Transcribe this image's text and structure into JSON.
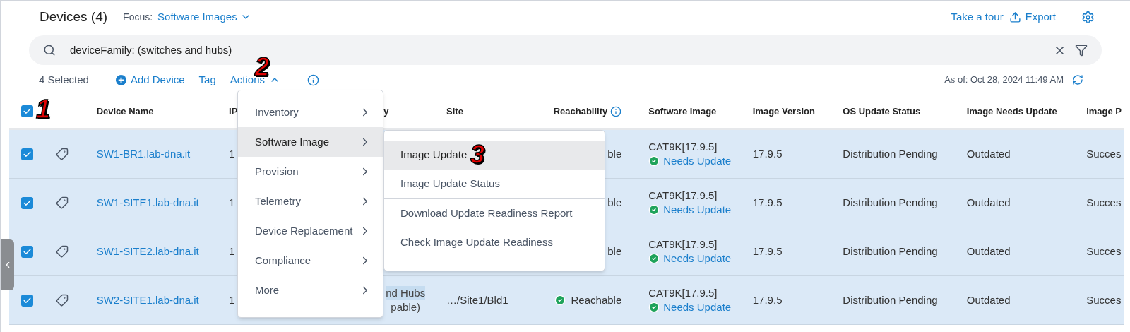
{
  "header": {
    "title": "Devices (4)",
    "focus_label": "Focus:",
    "focus_value": "Software Images",
    "links": [
      "Take a tour",
      "Export"
    ]
  },
  "search": {
    "value": "deviceFamily: (switches and hubs)"
  },
  "toolbar": {
    "selected_count": "4 Selected",
    "add_device": "Add Device",
    "tag": "Tag",
    "actions": "Actions",
    "actions_expanded": true,
    "as_of": "As of: Oct 28, 2024 11:49 AM"
  },
  "table": {
    "all_checked": true,
    "columns": [
      "Device Name",
      "IP",
      "y",
      "Site",
      "Reachability",
      "Software Image",
      "Image Version",
      "OS Update Status",
      "Image Needs Update",
      "Image P"
    ],
    "rows": [
      {
        "selected": true,
        "name": "SW1-BR1.lab-dna.it",
        "ip": "1",
        "reachability": "ble",
        "reachable_icon": false,
        "image": "CAT9K[17.9.5]",
        "image_status": "Needs Update",
        "version": "17.9.5",
        "os_status": "Distribution Pending",
        "needs_update": "Outdated",
        "column_10": "Succes"
      },
      {
        "selected": true,
        "name": "SW1-SITE1.lab-dna.it",
        "ip": "1",
        "reachability": "ble",
        "reachable_icon": false,
        "image": "CAT9K[17.9.5]",
        "image_status": "Needs Update",
        "version": "17.9.5",
        "os_status": "Distribution Pending",
        "needs_update": "Outdated",
        "column_10": "Succes"
      },
      {
        "selected": true,
        "name": "SW1-SITE2.lab-dna.it",
        "ip": "1",
        "reachability": "ble",
        "reachable_icon": false,
        "image": "CAT9K[17.9.5]",
        "image_status": "Needs Update",
        "version": "17.9.5",
        "os_status": "Distribution Pending",
        "needs_update": "Outdated",
        "column_10": "Succes"
      },
      {
        "selected": true,
        "name": "SW2-SITE1.lab-dna.it",
        "ip": "1",
        "family": [
          "nd Hubs",
          "pable)"
        ],
        "site": "…/Site1/Bld1",
        "reachability": "Reachable",
        "reachable_icon": true,
        "image": "CAT9K[17.9.5]",
        "image_status": "Needs Update",
        "version": "17.9.5",
        "os_status": "Distribution Pending",
        "needs_update": "Outdated",
        "column_10": "Succes"
      }
    ]
  },
  "actions_menu": [
    {
      "label": "Inventory",
      "selected": false
    },
    {
      "label": "Software Image",
      "selected": true
    },
    {
      "label": "Provision",
      "selected": false
    },
    {
      "label": "Telemetry",
      "selected": false
    },
    {
      "label": "Device Replacement",
      "selected": false
    },
    {
      "label": "Compliance",
      "selected": false
    },
    {
      "label": "More",
      "selected": false
    }
  ],
  "submenu_groups": [
    [
      {
        "label": "Image Update",
        "selected": true
      },
      {
        "label": "Image Update Status",
        "selected": false
      }
    ],
    [
      {
        "label": "Download Update Readiness Report",
        "selected": false
      },
      {
        "label": "Check Image Update Readiness",
        "selected": false
      }
    ]
  ],
  "annotations": [
    "1",
    "2",
    "3"
  ]
}
